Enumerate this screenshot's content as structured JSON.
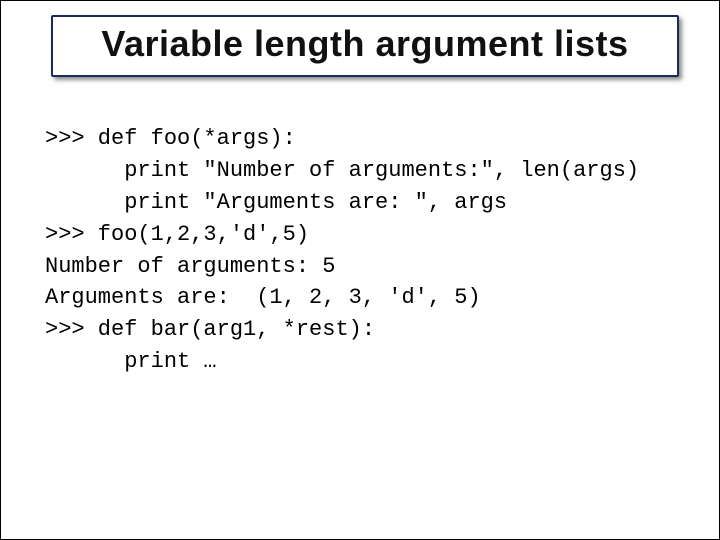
{
  "title": "Variable length argument lists",
  "code": {
    "l1": ">>> def foo(*args):",
    "l2": "      print \"Number of arguments:\", len(args)",
    "l3": "      print \"Arguments are: \", args",
    "l4": ">>> foo(1,2,3,'d',5)",
    "l5": "Number of arguments: 5",
    "l6": "Arguments are:  (1, 2, 3, 'd', 5)",
    "l7": ">>> def bar(arg1, *rest):",
    "l8": "      print …"
  }
}
